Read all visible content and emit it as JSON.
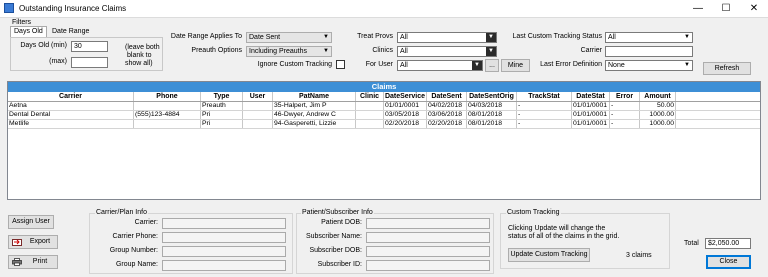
{
  "window": {
    "title": "Outstanding Insurance Claims",
    "minimize": "—",
    "maximize": "☐",
    "close": "✕"
  },
  "filters": {
    "group_label": "Filters",
    "tab_days_old": "Days Old",
    "tab_date_range": "Date Range",
    "days_old_min_label": "Days Old (min)",
    "days_old_min_value": "30",
    "days_old_max_label": "(max)",
    "days_old_max_value": "",
    "blank_note_1": "(leave both",
    "blank_note_2": "blank to",
    "blank_note_3": "show all)",
    "date_range_applies_label": "Date Range Applies To",
    "date_range_applies_value": "Date Sent",
    "preauth_label": "Preauth Options",
    "preauth_value": "Including Preauths",
    "ignore_tracking_label": "Ignore Custom Tracking",
    "treat_provs_label": "Treat Provs",
    "treat_provs_value": "All",
    "clinics_label": "Clinics",
    "clinics_value": "All",
    "for_user_label": "For User",
    "for_user_value": "All",
    "ellipsis_button": "...",
    "mine_button": "Mine",
    "last_custom_tracking_label": "Last Custom Tracking Status",
    "last_custom_tracking_value": "All",
    "carrier_label": "Carrier",
    "carrier_value": "",
    "last_error_label": "Last Error Definition",
    "last_error_value": "None",
    "refresh_button": "Refresh"
  },
  "claims": {
    "title": "Claims",
    "columns": [
      "Carrier",
      "Phone",
      "Type",
      "User",
      "PatName",
      "Clinic",
      "DateService",
      "DateSent",
      "DateSentOrig",
      "TrackStat",
      "DateStat",
      "Error",
      "Amount"
    ],
    "rows": [
      [
        "Aetna",
        "",
        "Preauth",
        "",
        "35-Halpert, Jim P",
        "",
        "01/01/0001",
        "04/02/2018",
        "04/03/2018",
        "-",
        "01/01/0001",
        "-",
        "50.00"
      ],
      [
        "Dental Dental",
        "(555)123-4884",
        "Pri",
        "",
        "46-Dwyer, Andrew C",
        "",
        "03/05/2018",
        "03/06/2018",
        "08/01/2018",
        "-",
        "01/01/0001",
        "-",
        "1000.00"
      ],
      [
        "Metlife",
        "",
        "Pri",
        "",
        "94-Gasperetti, Lizzie",
        "",
        "02/20/2018",
        "02/20/2018",
        "08/01/2018",
        "-",
        "01/01/0001",
        "-",
        "1000.00"
      ]
    ]
  },
  "carrier_info": {
    "group_label": "Carrier/Plan Info",
    "carrier_label": "Carrier:",
    "phone_label": "Carrier Phone:",
    "group_number_label": "Group Number:",
    "group_name_label": "Group Name:"
  },
  "patient_info": {
    "group_label": "Patient/Subscriber Info",
    "patient_dob_label": "Patient DOB:",
    "subscriber_name_label": "Subscriber Name:",
    "subscriber_dob_label": "Subscriber DOB:",
    "subscriber_id_label": "Subscriber ID:"
  },
  "custom_tracking": {
    "group_label": "Custom Tracking",
    "note_1": "Clicking Update will change the",
    "note_2": "status of all of the claims in the grid.",
    "update_button": "Update Custom Tracking",
    "claims_count": "3 claims"
  },
  "footer": {
    "assign_user_button": "Assign User",
    "export_button": "Export",
    "print_button": "Print",
    "total_label": "Total",
    "total_value": "$2,050.00",
    "close_button": "Close"
  },
  "colors": {
    "accent": "#3d8fd6"
  }
}
